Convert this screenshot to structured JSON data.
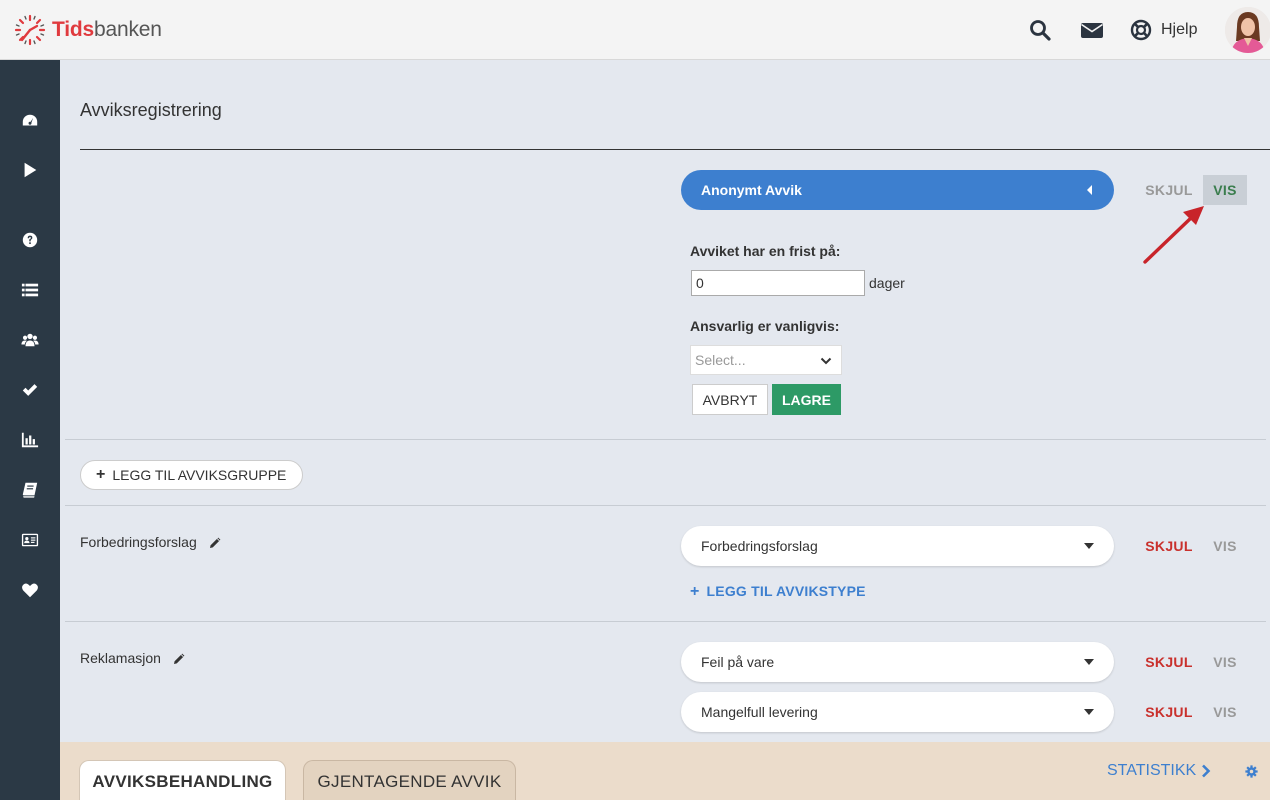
{
  "header": {
    "brand_part1": "Tids",
    "brand_part2": "banken",
    "help_label": "Hjelp"
  },
  "sidebar": {
    "items": [
      {
        "icon": "dashboard-icon"
      },
      {
        "icon": "play-icon"
      },
      {
        "icon": "question-icon"
      },
      {
        "icon": "list-icon"
      },
      {
        "icon": "users-icon"
      },
      {
        "icon": "check-icon"
      },
      {
        "icon": "bar-chart-icon"
      },
      {
        "icon": "book-icon"
      },
      {
        "icon": "id-card-icon"
      },
      {
        "icon": "heart-icon"
      }
    ]
  },
  "page": {
    "title": "Avviksregistrering"
  },
  "anonymous": {
    "label": "Anonymt Avvik",
    "hide_label": "SKJUL",
    "show_label": "VIS",
    "deadline_label": "Avviket har en frist på:",
    "deadline_value": "0",
    "deadline_unit": "dager",
    "responsible_label": "Ansvarlig er vanligvis:",
    "responsible_placeholder": "Select...",
    "cancel_label": "AVBRYT",
    "save_label": "LAGRE"
  },
  "add_group_label": "LEGG TIL AVVIKSGRUPPE",
  "groups": [
    {
      "name": "Forbedringsforslag",
      "types": [
        {
          "label": "Forbedringsforslag",
          "hide_label": "SKJUL",
          "show_label": "VIS"
        }
      ],
      "add_type_label": "LEGG TIL AVVIKSTYPE"
    },
    {
      "name": "Reklamasjon",
      "types": [
        {
          "label": "Feil på vare",
          "hide_label": "SKJUL",
          "show_label": "VIS"
        },
        {
          "label": "Mangelfull levering",
          "hide_label": "SKJUL",
          "show_label": "VIS"
        }
      ]
    }
  ],
  "bottom_tabs": {
    "tab1": "AVVIKSBEHANDLING",
    "tab2": "GJENTAGENDE AVVIK",
    "stat_label": "STATISTIKK"
  },
  "colors": {
    "brand_red": "#e03a3e",
    "accent_blue": "#3d7fcf",
    "save_green": "#2d9a66",
    "hide_red": "#c9302c",
    "sidebar": "#2b3945"
  }
}
